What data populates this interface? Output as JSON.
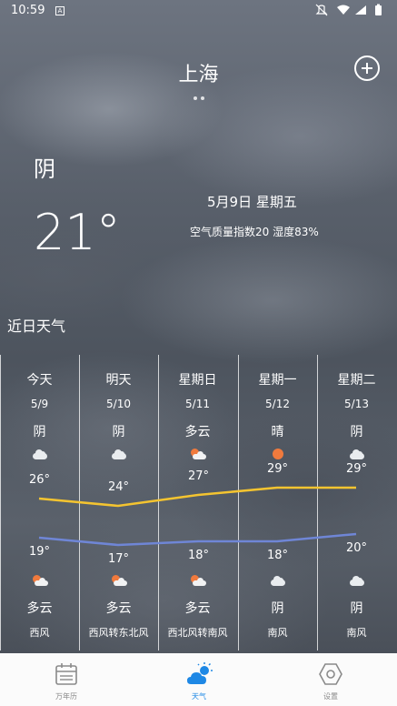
{
  "status_bar": {
    "time": "10:59",
    "left_badge": "A",
    "icons": [
      "mute-icon",
      "wifi-icon",
      "signal-icon",
      "battery-icon"
    ]
  },
  "header": {
    "city": "上海",
    "add_icon": "add-circle-icon"
  },
  "current": {
    "condition": "阴",
    "temperature": "21°",
    "date": "5月9日 星期五",
    "aqi_humidity": "空气质量指数20 湿度83%"
  },
  "forecast": {
    "title": "近日天气",
    "days": [
      {
        "name": "今天",
        "date": "5/9",
        "day_condition": "阴",
        "day_icon": "cloudy-icon",
        "high": 26,
        "high_label": "26°",
        "low": 19,
        "low_label": "19°",
        "night_icon": "partly-cloudy-icon",
        "night_condition": "多云",
        "wind": "西风"
      },
      {
        "name": "明天",
        "date": "5/10",
        "day_condition": "阴",
        "day_icon": "cloudy-icon",
        "high": 24,
        "high_label": "24°",
        "low": 17,
        "low_label": "17°",
        "night_icon": "partly-cloudy-icon",
        "night_condition": "多云",
        "wind": "西风转东北风"
      },
      {
        "name": "星期日",
        "date": "5/11",
        "day_condition": "多云",
        "day_icon": "partly-cloudy-icon",
        "high": 27,
        "high_label": "27°",
        "low": 18,
        "low_label": "18°",
        "night_icon": "partly-cloudy-icon",
        "night_condition": "多云",
        "wind": "西北风转南风"
      },
      {
        "name": "星期一",
        "date": "5/12",
        "day_condition": "晴",
        "day_icon": "sunny-icon",
        "high": 29,
        "high_label": "29°",
        "low": 18,
        "low_label": "18°",
        "night_icon": "cloudy-icon",
        "night_condition": "阴",
        "wind": "南风"
      },
      {
        "name": "星期二",
        "date": "5/13",
        "day_condition": "阴",
        "day_icon": "cloudy-icon",
        "high": 29,
        "high_label": "29°",
        "low": 20,
        "low_label": "20°",
        "night_icon": "cloudy-icon",
        "night_condition": "阴",
        "wind": "南风"
      }
    ],
    "high_line_color": "#f4c430",
    "low_line_color": "#6f86d6"
  },
  "bottom_nav": {
    "items": [
      {
        "label": "万年历",
        "icon": "calendar-icon"
      },
      {
        "label": "天气",
        "icon": "weather-icon"
      },
      {
        "label": "设置",
        "icon": "settings-hexagon-icon"
      }
    ],
    "active_color": "#1e88e5"
  }
}
